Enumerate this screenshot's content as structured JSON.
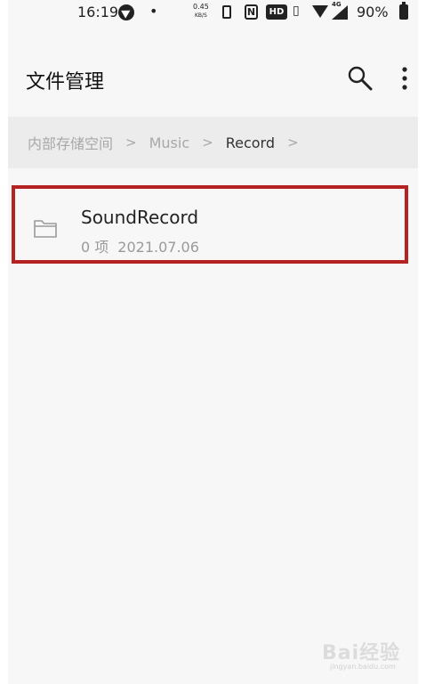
{
  "status_bar": {
    "time": "16:19",
    "dot": "•",
    "net_speed": "0.45",
    "net_speed_unit": "KB/S",
    "nfc": "N",
    "hd": "HD",
    "network_type": "4G",
    "battery": "90%"
  },
  "app_bar": {
    "title": "文件管理",
    "icons": [
      "search-icon",
      "more-vert-icon"
    ]
  },
  "breadcrumb": {
    "items": [
      "内部存储空间",
      "Music",
      "Record"
    ],
    "separator": ">"
  },
  "file_list": {
    "items": [
      {
        "icon": "folder-icon",
        "name": "SoundRecord",
        "count": "0 项",
        "date": "2021.07.06"
      }
    ]
  },
  "watermark": {
    "text": "Bai经验",
    "sub": "jingyan.baidu.com"
  },
  "colors": {
    "highlight_border": "#b42222",
    "breadcrumb_bg": "#ececec",
    "page_bg": "#f7f7f7"
  }
}
